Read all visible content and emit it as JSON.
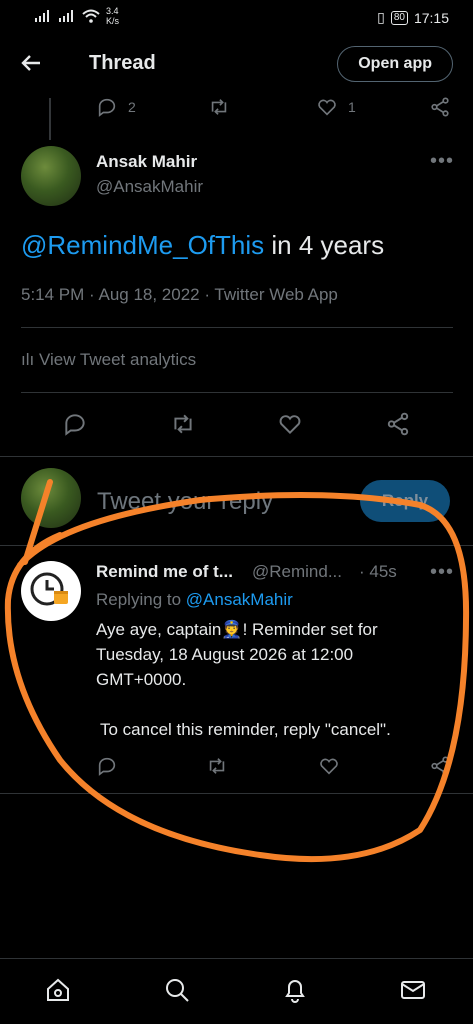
{
  "status_bar": {
    "net_speed": "3.4",
    "net_unit": "K/s",
    "battery": "80",
    "time": "17:15"
  },
  "header": {
    "title": "Thread",
    "open_app": "Open app"
  },
  "top_actions": {
    "reply_count": "2",
    "like_count": "1"
  },
  "main_tweet": {
    "name": "Ansak Mahir",
    "handle": "@AnsakMahir",
    "mention": "@RemindMe_OfThis",
    "text_rest": " in 4 years",
    "meta": "5:14 PM · Aug 18, 2022 · Twitter Web App",
    "analytics": "View Tweet analytics"
  },
  "composer": {
    "placeholder": "Tweet your reply",
    "reply_button": "Reply"
  },
  "reply_tweet": {
    "name": "Remind me of t...",
    "handle": "@Remind...",
    "time": "· 45s",
    "replying_prefix": "Replying to ",
    "replying_to": "@AnsakMahir",
    "body_1": "Aye aye, captain",
    "emoji": "👮",
    "body_1b": "! Reminder set for",
    "body_2": "Tuesday, 18 August 2026 at 12:00",
    "body_3": "GMT+0000.",
    "body_4": "To cancel this reminder, reply \"cancel\"."
  },
  "colors": {
    "accent": "#1d9bf0",
    "annotation": "#f5822a",
    "background": "#000000"
  },
  "bottom_nav": [
    "home-icon",
    "search-icon",
    "notifications-icon",
    "messages-icon"
  ]
}
